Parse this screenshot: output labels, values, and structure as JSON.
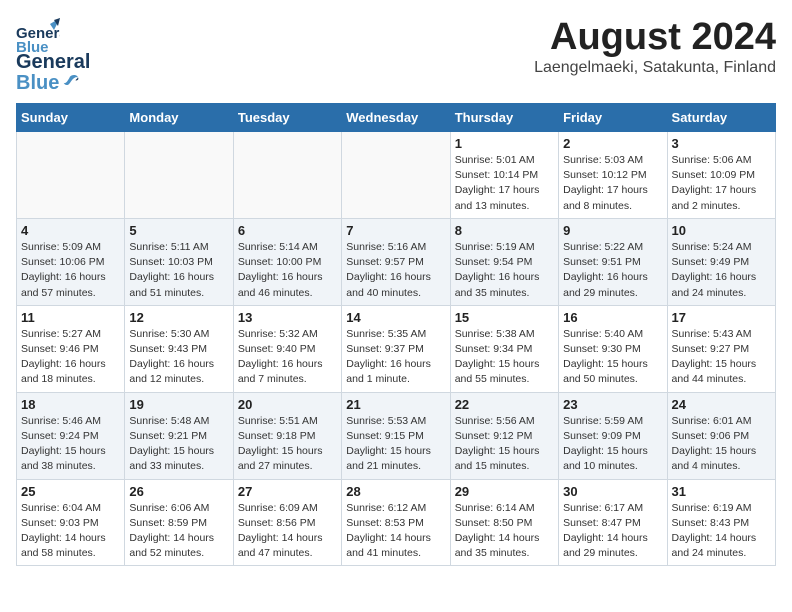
{
  "logo": {
    "line1": "General",
    "line2": "Blue"
  },
  "title": "August 2024",
  "subtitle": "Laengelmaeki, Satakunta, Finland",
  "days_of_week": [
    "Sunday",
    "Monday",
    "Tuesday",
    "Wednesday",
    "Thursday",
    "Friday",
    "Saturday"
  ],
  "weeks": [
    [
      {
        "day": "",
        "info": ""
      },
      {
        "day": "",
        "info": ""
      },
      {
        "day": "",
        "info": ""
      },
      {
        "day": "",
        "info": ""
      },
      {
        "day": "1",
        "info": "Sunrise: 5:01 AM\nSunset: 10:14 PM\nDaylight: 17 hours\nand 13 minutes."
      },
      {
        "day": "2",
        "info": "Sunrise: 5:03 AM\nSunset: 10:12 PM\nDaylight: 17 hours\nand 8 minutes."
      },
      {
        "day": "3",
        "info": "Sunrise: 5:06 AM\nSunset: 10:09 PM\nDaylight: 17 hours\nand 2 minutes."
      }
    ],
    [
      {
        "day": "4",
        "info": "Sunrise: 5:09 AM\nSunset: 10:06 PM\nDaylight: 16 hours\nand 57 minutes."
      },
      {
        "day": "5",
        "info": "Sunrise: 5:11 AM\nSunset: 10:03 PM\nDaylight: 16 hours\nand 51 minutes."
      },
      {
        "day": "6",
        "info": "Sunrise: 5:14 AM\nSunset: 10:00 PM\nDaylight: 16 hours\nand 46 minutes."
      },
      {
        "day": "7",
        "info": "Sunrise: 5:16 AM\nSunset: 9:57 PM\nDaylight: 16 hours\nand 40 minutes."
      },
      {
        "day": "8",
        "info": "Sunrise: 5:19 AM\nSunset: 9:54 PM\nDaylight: 16 hours\nand 35 minutes."
      },
      {
        "day": "9",
        "info": "Sunrise: 5:22 AM\nSunset: 9:51 PM\nDaylight: 16 hours\nand 29 minutes."
      },
      {
        "day": "10",
        "info": "Sunrise: 5:24 AM\nSunset: 9:49 PM\nDaylight: 16 hours\nand 24 minutes."
      }
    ],
    [
      {
        "day": "11",
        "info": "Sunrise: 5:27 AM\nSunset: 9:46 PM\nDaylight: 16 hours\nand 18 minutes."
      },
      {
        "day": "12",
        "info": "Sunrise: 5:30 AM\nSunset: 9:43 PM\nDaylight: 16 hours\nand 12 minutes."
      },
      {
        "day": "13",
        "info": "Sunrise: 5:32 AM\nSunset: 9:40 PM\nDaylight: 16 hours\nand 7 minutes."
      },
      {
        "day": "14",
        "info": "Sunrise: 5:35 AM\nSunset: 9:37 PM\nDaylight: 16 hours\nand 1 minute."
      },
      {
        "day": "15",
        "info": "Sunrise: 5:38 AM\nSunset: 9:34 PM\nDaylight: 15 hours\nand 55 minutes."
      },
      {
        "day": "16",
        "info": "Sunrise: 5:40 AM\nSunset: 9:30 PM\nDaylight: 15 hours\nand 50 minutes."
      },
      {
        "day": "17",
        "info": "Sunrise: 5:43 AM\nSunset: 9:27 PM\nDaylight: 15 hours\nand 44 minutes."
      }
    ],
    [
      {
        "day": "18",
        "info": "Sunrise: 5:46 AM\nSunset: 9:24 PM\nDaylight: 15 hours\nand 38 minutes."
      },
      {
        "day": "19",
        "info": "Sunrise: 5:48 AM\nSunset: 9:21 PM\nDaylight: 15 hours\nand 33 minutes."
      },
      {
        "day": "20",
        "info": "Sunrise: 5:51 AM\nSunset: 9:18 PM\nDaylight: 15 hours\nand 27 minutes."
      },
      {
        "day": "21",
        "info": "Sunrise: 5:53 AM\nSunset: 9:15 PM\nDaylight: 15 hours\nand 21 minutes."
      },
      {
        "day": "22",
        "info": "Sunrise: 5:56 AM\nSunset: 9:12 PM\nDaylight: 15 hours\nand 15 minutes."
      },
      {
        "day": "23",
        "info": "Sunrise: 5:59 AM\nSunset: 9:09 PM\nDaylight: 15 hours\nand 10 minutes."
      },
      {
        "day": "24",
        "info": "Sunrise: 6:01 AM\nSunset: 9:06 PM\nDaylight: 15 hours\nand 4 minutes."
      }
    ],
    [
      {
        "day": "25",
        "info": "Sunrise: 6:04 AM\nSunset: 9:03 PM\nDaylight: 14 hours\nand 58 minutes."
      },
      {
        "day": "26",
        "info": "Sunrise: 6:06 AM\nSunset: 8:59 PM\nDaylight: 14 hours\nand 52 minutes."
      },
      {
        "day": "27",
        "info": "Sunrise: 6:09 AM\nSunset: 8:56 PM\nDaylight: 14 hours\nand 47 minutes."
      },
      {
        "day": "28",
        "info": "Sunrise: 6:12 AM\nSunset: 8:53 PM\nDaylight: 14 hours\nand 41 minutes."
      },
      {
        "day": "29",
        "info": "Sunrise: 6:14 AM\nSunset: 8:50 PM\nDaylight: 14 hours\nand 35 minutes."
      },
      {
        "day": "30",
        "info": "Sunrise: 6:17 AM\nSunset: 8:47 PM\nDaylight: 14 hours\nand 29 minutes."
      },
      {
        "day": "31",
        "info": "Sunrise: 6:19 AM\nSunset: 8:43 PM\nDaylight: 14 hours\nand 24 minutes."
      }
    ]
  ]
}
